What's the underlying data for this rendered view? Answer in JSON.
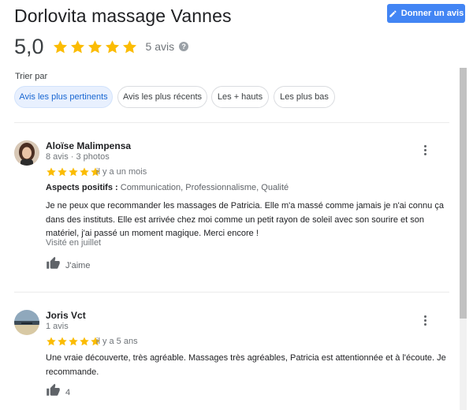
{
  "header": {
    "title": "Dorlovita massage Vannes",
    "write_review_label": "Donner un avis"
  },
  "rating": {
    "value": "5,0",
    "stars": 5,
    "count_label": "5 avis",
    "help_symbol": "?"
  },
  "sort": {
    "label": "Trier par",
    "chips": [
      {
        "label": "Avis les plus pertinents",
        "active": true
      },
      {
        "label": "Avis les plus récents",
        "active": false
      },
      {
        "label": "Les + hauts",
        "active": false
      },
      {
        "label": "Les plus bas",
        "active": false
      }
    ]
  },
  "reviews": [
    {
      "name": "Aloïse Malimpensa",
      "meta": "8 avis · 3 photos",
      "stars": 5,
      "when": "il y a un mois",
      "aspects_label": "Aspects positifs :",
      "aspects_value": "Communication, Professionnalisme, Qualité",
      "text": "Je ne peux que recommander les massages de Patricia. Elle m'a massé comme jamais je n'ai connu ça dans des instituts. Elle est arrivée chez moi comme un petit rayon de soleil avec son sourire et son matériel, j'ai passé un moment magique. Merci encore !",
      "visited": "Visité en juillet",
      "like_label": "J'aime"
    },
    {
      "name": "Joris Vct",
      "meta": "1 avis",
      "stars": 5,
      "when": "il y a 5 ans",
      "text": "Une vraie découverte, très agréable. Massages très agréables, Patricia est attentionnée et à l'écoute. Je recommande.",
      "like_label": "4"
    }
  ],
  "colors": {
    "star": "#fbbc04",
    "accent": "#4285f4",
    "active_chip_bg": "#e8f0fe",
    "active_chip_text": "#1967d2"
  }
}
